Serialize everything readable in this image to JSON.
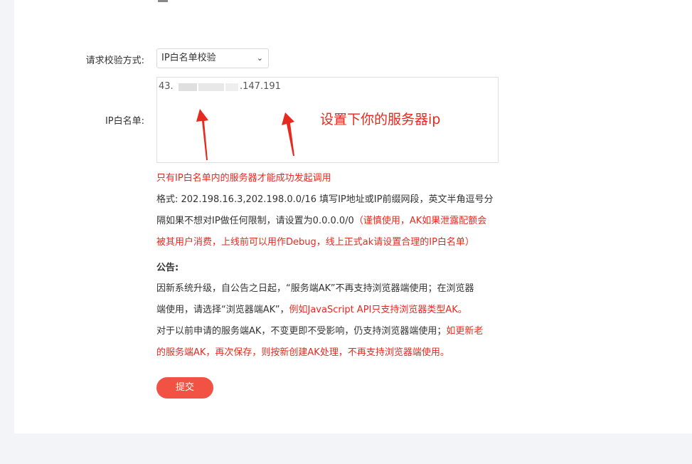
{
  "form": {
    "method_label": "请求校验方式:",
    "method_value": "IP白名单校验",
    "ip_label": "IP白名单:",
    "ip_value_prefix": "43.",
    "ip_value_suffix": ".147.191",
    "annotation": "设置下你的服务器ip",
    "help_red": "只有IP白名单内的服务器才能成功发起调用",
    "format_line1": "格式: 202.198.16.3,202.198.0.0/16 填写IP地址或IP前缀网段，英文半角逗号分",
    "format_line2_black": "隔如果不想对IP做任何限制，请设置为0.0.0.0/0",
    "format_line2_red": "（谨慎使用，AK如果泄露配额会",
    "format_line3_red": "被其用户消费，上线前可以用作Debug，线上正式ak请设置合理的IP白名单）",
    "notice_title": "公告:",
    "notice_l1": "因新系统升级，自公告之日起，“服务端AK”不再支持浏览器端使用；在浏览器",
    "notice_l2_black": "端使用，请选择“浏览器端AK”，",
    "notice_l2_red": "例如JavaScript API只支持浏览器类型AK。",
    "notice_l3_black": "对于以前申请的服务端AK，不变更即不受影响，仍支持浏览器端使用；",
    "notice_l3_red": "如更新老",
    "notice_l4_red": "的服务端AK，再次保存，则按新创建AK处理，不再支持浏览器端使用。",
    "submit_label": "提交"
  },
  "colors": {
    "accent": "#f25244",
    "warning_text": "#e8291f"
  }
}
